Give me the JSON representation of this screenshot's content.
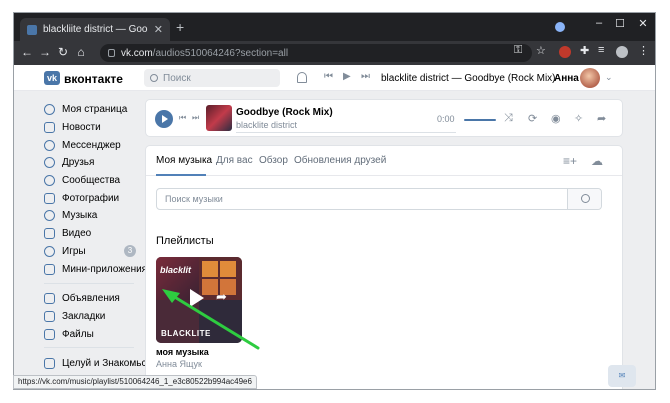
{
  "browser": {
    "tab_title": "blackliite district — Goodbye (Ro",
    "tab_close": "✕",
    "new_tab": "+",
    "url_host": "vk.com",
    "url_path": "/audios510064246?section=all",
    "window_controls": [
      "–",
      "☐",
      "✕"
    ],
    "status_url": "https://vk.com/music/playlist/510064246_1_e3c80522b994ac49e6"
  },
  "vk_header": {
    "wordmark": "вконтакте",
    "logo_letters": "vk",
    "search_placeholder": "Поиск",
    "now_playing": "blacklite district — Goodbye (Rock Mix)",
    "user_name": "Анна"
  },
  "left_nav": {
    "items": [
      {
        "label": "Моя страница",
        "icon": "user-icon"
      },
      {
        "label": "Новости",
        "icon": "news-icon"
      },
      {
        "label": "Мессенджер",
        "icon": "chat-icon"
      },
      {
        "label": "Друзья",
        "icon": "friends-icon"
      },
      {
        "label": "Сообщества",
        "icon": "groups-icon"
      },
      {
        "label": "Фотографии",
        "icon": "photo-icon"
      },
      {
        "label": "Музыка",
        "icon": "music-icon"
      },
      {
        "label": "Видео",
        "icon": "video-icon"
      },
      {
        "label": "Игры",
        "icon": "games-icon",
        "badge": "3"
      },
      {
        "label": "Мини-приложения",
        "icon": "apps-icon"
      },
      {
        "label": "Объявления",
        "icon": "ads-icon"
      },
      {
        "label": "Закладки",
        "icon": "bookmark-icon"
      },
      {
        "label": "Файлы",
        "icon": "files-icon"
      },
      {
        "label": "Целуй и Знакомься",
        "icon": "app-icon"
      }
    ]
  },
  "player": {
    "title": "Goodbye (Rock Mix)",
    "artist": "blacklite district",
    "time": "0:00"
  },
  "music": {
    "tabs": [
      "Моя музыка",
      "Для вас",
      "Обзор",
      "Обновления друзей"
    ],
    "search_placeholder": "Поиск музыки",
    "section_title": "Плейлисты",
    "playlist": {
      "cover_text": "blacklit",
      "cover_bottom": "BLACKLITE",
      "name": "моя музыка",
      "owner": "Анна Ящук"
    }
  },
  "colors": {
    "accent": "#4a76a8",
    "annotation_arrow": "#2ecc40"
  }
}
